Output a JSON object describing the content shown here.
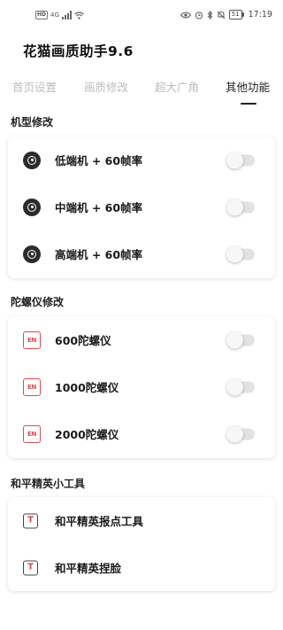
{
  "status_bar": {
    "hd": "HD",
    "signal": "4G",
    "battery": "51",
    "time": "17:19"
  },
  "app": {
    "title": "花猫画质助手9.6"
  },
  "tabs": [
    {
      "label": "首页设置",
      "active": false
    },
    {
      "label": "画质修改",
      "active": false
    },
    {
      "label": "超大广角",
      "active": false
    },
    {
      "label": "其他功能",
      "active": true
    }
  ],
  "sections": [
    {
      "title": "机型修改",
      "icon": "disc-icon",
      "items": [
        {
          "label": "低端机 + 60帧率",
          "enabled": false
        },
        {
          "label": "中端机 + 60帧率",
          "enabled": false
        },
        {
          "label": "高端机 + 60帧率",
          "enabled": false
        }
      ]
    },
    {
      "title": "陀螺仪修改",
      "icon": "en-icon",
      "icon_text": "EN",
      "items": [
        {
          "label": "600陀螺仪",
          "enabled": false
        },
        {
          "label": "1000陀螺仪",
          "enabled": false
        },
        {
          "label": "2000陀螺仪",
          "enabled": false
        }
      ]
    },
    {
      "title": "和平精英小工具",
      "icon": "t-box-icon",
      "icon_text": "T",
      "items": [
        {
          "label": "和平精英报点工具"
        },
        {
          "label": "和平精英捏脸"
        }
      ]
    }
  ],
  "colors": {
    "accent_red": "#d94a4a",
    "tab_inactive": "#bdbdbd",
    "tab_active": "#222222"
  }
}
